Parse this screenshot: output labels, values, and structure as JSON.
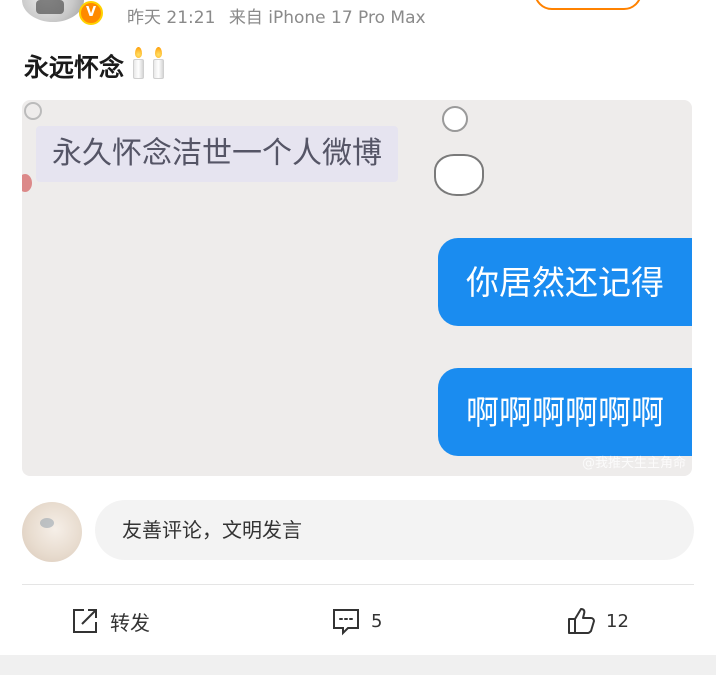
{
  "header": {
    "time": "昨天 21:21",
    "source": "来自 iPhone 17 Pro Max",
    "verified_badge": "V"
  },
  "post": {
    "text": "永远怀念",
    "emoji": [
      "candle-icon",
      "candle-icon"
    ]
  },
  "image": {
    "left_message": "永久怀念洁世一个人微博",
    "bubbles": [
      "你居然还记得",
      "啊啊啊啊啊啊"
    ],
    "watermark": "@我推天生主角命"
  },
  "comment": {
    "placeholder": "友善评论，文明发言"
  },
  "actions": {
    "repost_label": "转发",
    "comment_count": "5",
    "like_count": "12"
  },
  "colors": {
    "bubble_blue": "#1a8cf0",
    "badge_orange": "#ff8a00",
    "follow_orange": "#ff8200"
  }
}
